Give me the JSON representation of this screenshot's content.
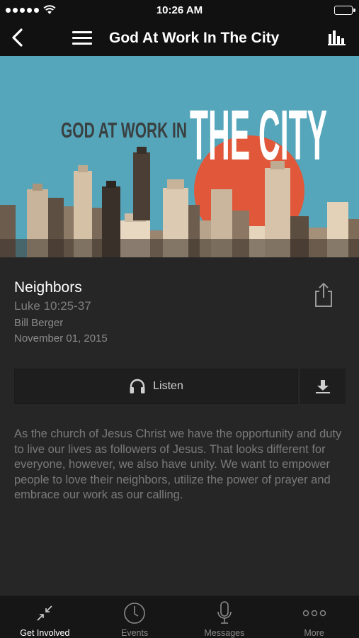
{
  "status_bar": {
    "time": "10:26 AM"
  },
  "nav": {
    "title": "God At Work In The City"
  },
  "banner": {
    "line1": "GOD AT WORK IN",
    "line2": "THE CITY"
  },
  "sermon": {
    "title": "Neighbors",
    "scripture": "Luke 10:25-37",
    "speaker": "Bill Berger",
    "date": "November 01, 2015"
  },
  "actions": {
    "listen_label": "Listen"
  },
  "description": "As the church of Jesus Christ we have the opportunity and duty to live our lives as followers of Jesus. That looks different for everyone, however, we also have unity. We want to empower people to love their neighbors, utilize the power of prayer and embrace our work as our calling.",
  "tabs": [
    {
      "label": "Get Involved",
      "icon": "get-involved-icon",
      "active": true
    },
    {
      "label": "Events",
      "icon": "clock-icon",
      "active": false
    },
    {
      "label": "Messages",
      "icon": "microphone-icon",
      "active": false
    },
    {
      "label": "More",
      "icon": "more-icon",
      "active": false
    }
  ],
  "colors": {
    "background": "#262626",
    "nav_background": "#111111",
    "banner_sky": "#58a8bd",
    "banner_sun": "#e0573a",
    "muted_text": "#7a7a7a"
  }
}
